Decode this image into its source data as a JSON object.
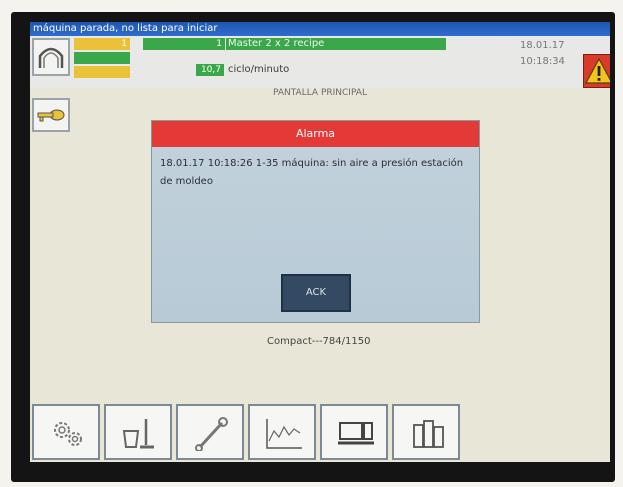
{
  "header": {
    "status_text": "máquina parada, no lista para iniciar",
    "counter_1": "1",
    "counter_2": "1",
    "recipe": "Master 2 x 2 recipe",
    "rate_value": "10,7",
    "rate_unit": "ciclo/minuto",
    "date": "18.01.17",
    "time": "10:18:34",
    "screen_title": "PANTALLA PRINCIPAL"
  },
  "dialog": {
    "title": "Alarma",
    "message": "18.01.17 10:18:26 1-35 máquina: sin aire a presión estación de moldeo",
    "ack_label": "ACK"
  },
  "footer": {
    "product": "Compact---784/1150"
  },
  "toolbar_icons": [
    "gears-icon",
    "cleaning-bucket-icon",
    "wrench-icon",
    "trend-chart-icon",
    "machine-monitor-icon",
    "documents-icon"
  ],
  "colors": {
    "titlebar": "#1e57b0",
    "alarm_red": "#e33a38",
    "status_green": "#3aa84a",
    "status_yellow": "#e9c23a"
  }
}
